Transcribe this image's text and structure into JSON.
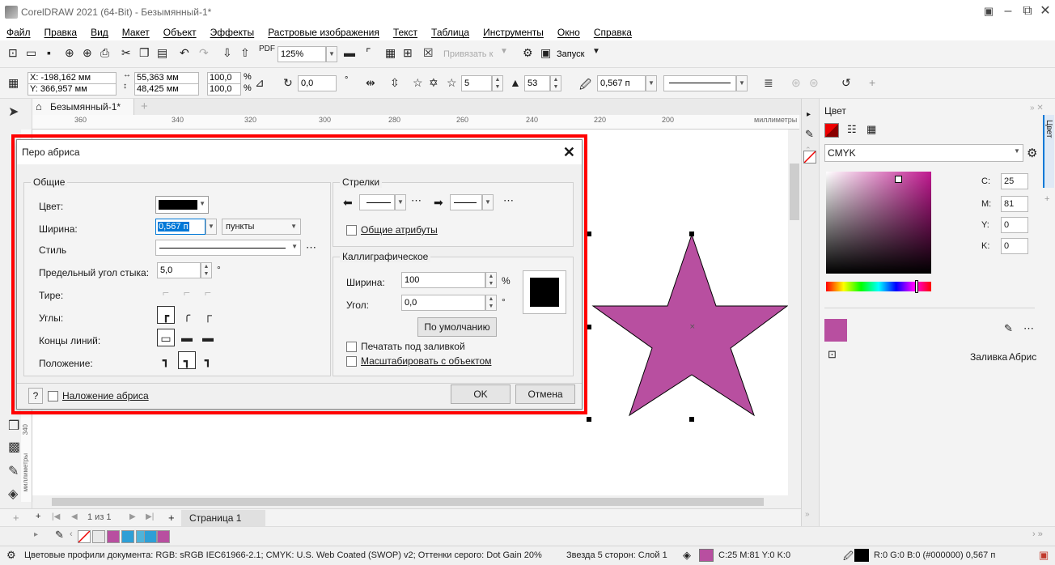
{
  "window": {
    "title": "CorelDRAW 2021 (64-Bit) - Безымянный-1*",
    "min": "–",
    "restore": "⧉",
    "close": "✕"
  },
  "menu": [
    "Файл",
    "Правка",
    "Вид",
    "Макет",
    "Объект",
    "Эффекты",
    "Растровые изображения",
    "Текст",
    "Таблица",
    "Инструменты",
    "Окно",
    "Справка"
  ],
  "toolbar1": {
    "zoom": "125%",
    "snap_label": "Привязать к",
    "launch_label": "Запуск"
  },
  "toolbar2": {
    "x": "X: -198,162 мм",
    "y": "Y: 366,957 мм",
    "w": "55,363 мм",
    "h": "48,425 мм",
    "scale_x": "100,0",
    "scale_y": "100,0",
    "pct": "%",
    "angle": "0,0",
    "deg": "°",
    "points": "5",
    "sharpness": "53",
    "outline_width": "0,567 п"
  },
  "document": {
    "tab": "Безымянный-1*",
    "add_tab": "+",
    "ruler_units": "миллиметры",
    "ruler_labels": [
      "360",
      "340",
      "320",
      "300",
      "280",
      "260",
      "240",
      "220",
      "200"
    ],
    "left_ruler_value": "340",
    "left_ruler_units": "миллиметры"
  },
  "pagenav": {
    "page_count": "1 из 1",
    "page_tab": "Страница 1"
  },
  "dialog": {
    "title": "Перо абриса",
    "close": "✕",
    "general": {
      "legend": "Общие",
      "color_label": "Цвет:",
      "width_label": "Ширина:",
      "width_value": "0,567 п",
      "units_value": "пункты",
      "style_label": "Стиль",
      "miter_label": "Предельный угол стыка:",
      "miter_value": "5,0",
      "miter_unit": "°",
      "dash_label": "Тире:",
      "corners_label": "Углы:",
      "caps_label": "Концы линий:",
      "position_label": "Положение:"
    },
    "arrows": {
      "legend": "Стрелки",
      "shared_attr": "Общие атрибуты"
    },
    "calligraphy": {
      "legend": "Каллиграфическое",
      "width_label": "Ширина:",
      "width_value": "100",
      "width_unit": "%",
      "angle_label": "Угол:",
      "angle_value": "0,0",
      "angle_unit": "°",
      "default_button": "По умолчанию",
      "print_behind": "Печатать под заливкой",
      "scale_with_object": "Масштабировать с объектом"
    },
    "help": "?",
    "overprint": "Наложение абриса",
    "ok": "OK",
    "cancel": "Отмена"
  },
  "docker": {
    "title": "Цвет",
    "side_tab": "Цвет",
    "model": "CMYK",
    "c_label": "C:",
    "c_value": "25",
    "m_label": "M:",
    "m_value": "81",
    "y_label": "Y:",
    "y_value": "0",
    "k_label": "K:",
    "k_value": "0",
    "fill_label": "Заливка",
    "outline_label": "Абрис"
  },
  "status": {
    "color_profiles": "Цветовые профили документа: RGB: sRGB IEC61966-2.1; CMYK: U.S. Web Coated (SWOP) v2; Оттенки серого: Dot Gain 20%",
    "object_info": "Звезда 5 сторон: Слой 1",
    "fill_info": "C:25 M:81 Y:0 K:0",
    "outline_info": "R:0 G:0 B:0 (#000000)  0,567 п"
  },
  "colors": {
    "star_fill": "#b84fa0",
    "highlight": "#ff0000",
    "accent": "#0078d7"
  },
  "palette": [
    "#e8e8e8",
    "#b84fa0",
    "#2e9fd6",
    "#4fb3d9",
    "#2e9fd6",
    "#b84fa0"
  ]
}
